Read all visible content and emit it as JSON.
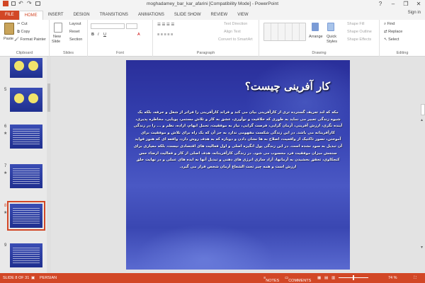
{
  "window": {
    "title": "moghadamey_bar_kar_afarini [Compatibility Mode] - PowerPoint",
    "controls": [
      "?",
      "–",
      "❐",
      "✕"
    ]
  },
  "tabs": [
    {
      "label": "FILE"
    },
    {
      "label": "HOME"
    },
    {
      "label": "INSERT"
    },
    {
      "label": "DESIGN"
    },
    {
      "label": "TRANSITIONS"
    },
    {
      "label": "ANIMATIONS"
    },
    {
      "label": "SLIDE SHOW"
    },
    {
      "label": "REVIEW"
    },
    {
      "label": "VIEW"
    }
  ],
  "signin": "Sign in",
  "ribbon": {
    "clipboard": {
      "label": "Clipboard",
      "paste": "Paste",
      "cut": "Cut",
      "copy": "Copy",
      "format_painter": "Format Painter"
    },
    "slides": {
      "label": "Slides",
      "new_slide": "New",
      "new_slide2": "Slide",
      "layout": "Layout",
      "reset": "Reset",
      "section": "Section"
    },
    "font": {
      "label": "Font"
    },
    "paragraph": {
      "label": "Paragraph",
      "text_direction": "Text Direction",
      "align_text": "Align Text",
      "convert_smartart": "Convert to SmartArt"
    },
    "drawing": {
      "label": "Drawing",
      "arrange": "Arrange",
      "quick_styles": "Quick",
      "quick_styles2": "Styles",
      "shape_fill": "Shape Fill",
      "shape_outline": "Shape Outline",
      "shape_effects": "Shape Effects"
    },
    "editing": {
      "label": "Editing",
      "find": "Find",
      "replace": "Replace",
      "select": "Select"
    }
  },
  "thumbnails": [
    {
      "number": "",
      "starred": false,
      "kind": "circles"
    },
    {
      "number": "5",
      "starred": false,
      "kind": "circles"
    },
    {
      "number": "6",
      "starred": true,
      "kind": "text"
    },
    {
      "number": "7",
      "starred": true,
      "kind": "text"
    },
    {
      "number": "8",
      "starred": true,
      "kind": "text",
      "selected": true
    },
    {
      "number": "9",
      "starred": false,
      "kind": "text"
    }
  ],
  "slide": {
    "title": "کار آفرینی چیست؟",
    "body": "مکه که لند تعریف گسترده تری از کارآفرینی بیان می کند و فراند کارآفرینی را فراتر از شغل و حرفه، بلکه یک شیوه زندگی تعبیر می نماید به طوری که خلاقیت و نوآوری، عشق به کار و تلاش مستمر، پویایی، مخاطره پذیری، آینده نگری، ارزش آفرینی، آرمان گرایی، فرصت گرایی، نیاز به موفقیت، تحمل ابهام، اراده، نظم و ... را در زندگی کارآفرینانه می باشد. در این زندگی شکست مفهومی ندارد به جز آن که یک راه برای تلاش و موفقیت برای آموختن، تصور تاکتیک از واقعیت، اصلاح به ها نشان دادن و دوباره که به هدف روش دارد، وافعه ای که هنوز فواید آن تبدیل به سود نشده است. در این زندگی پول انگیزه اصلی و اول فعالیت های اقتصادی نیست، بلکه معیاری برای سنجش میزان موفقیت فرد محسوب می شود. در زندگی کارآفرینانه، هدف اصلی از کار و فعالیت ارضاء حس کنجکاوی، تحقق بخشیدن به آرمانها، آزاد سازی انرژی های ذهنی و تبدیل آنها به ایده های عملی و در نهایت خلق ارزش است و همه چیز تحت الشعاع آرمان شخص قرار می گیرد."
  },
  "status": {
    "slide_counter": "SLIDE 8 OF 31",
    "language": "PERSIAN",
    "notes": "NOTES",
    "comments": "COMMENTS",
    "zoom": "74 %"
  },
  "colors": {
    "accent": "#d24726",
    "slide_bg": "#3440b0"
  }
}
